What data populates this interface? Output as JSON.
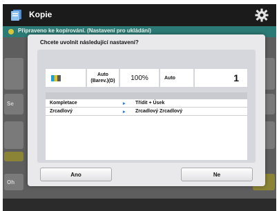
{
  "app": {
    "title": "Kopie",
    "icon": "copy-app-icon",
    "settings_icon": "gear-icon"
  },
  "status_bar": {
    "text": "Připraveno ke kopírování. (Nastavení pro ukládání)"
  },
  "background": {
    "side_label_1": "Se",
    "side_label_2": "Oh"
  },
  "dialog": {
    "title": "Chcete uvolnit následující nastavení?",
    "settings": {
      "color_mode": "",
      "paper": "Auto\n(Barev.)(D)",
      "zoom": "100%",
      "density": "Auto",
      "copies": "1"
    },
    "options": [
      {
        "name": "Kompletace",
        "value": "Třídit + Úsek"
      },
      {
        "name": "Zrcadlový",
        "value": "Zrcadlový Zrcadlový"
      }
    ],
    "buttons": {
      "yes": "Ano",
      "no": "Ne"
    }
  },
  "colors": {
    "topbar": "#1b1b1b",
    "statusbar": "#2c7a75",
    "accent_arrow": "#2e7fc6"
  }
}
